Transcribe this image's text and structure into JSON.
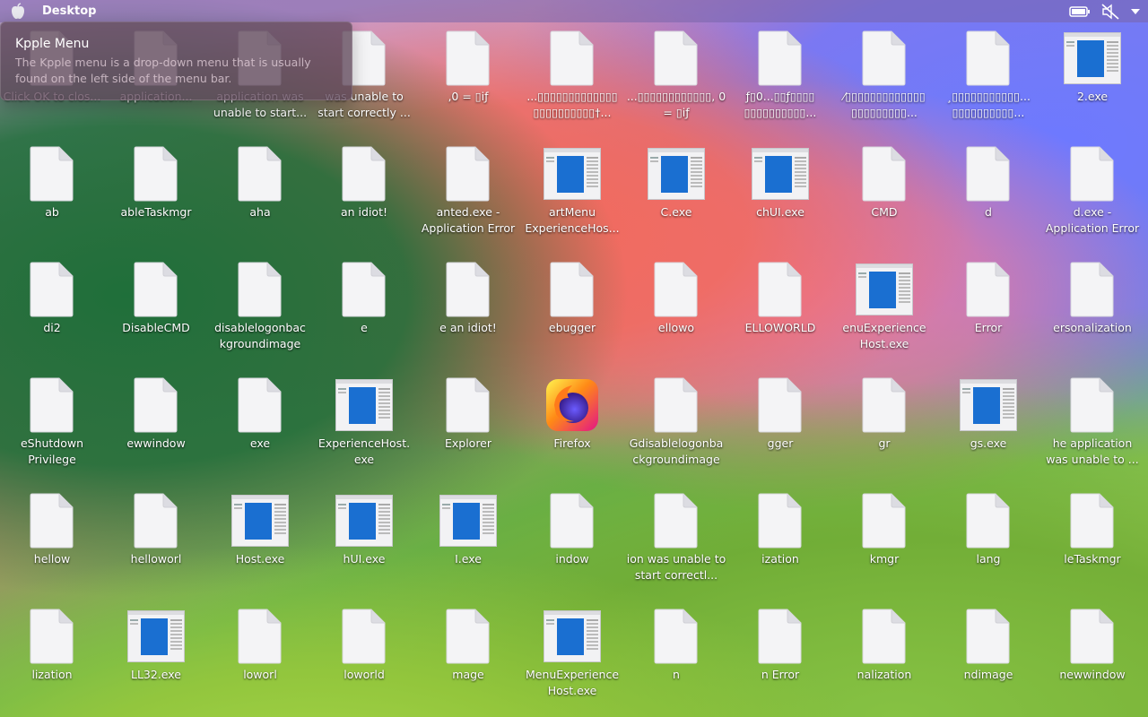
{
  "menubar": {
    "title": "Desktop"
  },
  "tooltip": {
    "title": "Kpple Menu",
    "body": "The Kpple menu is a drop-down menu that is usually found on the left side of the menu bar."
  },
  "desktop": {
    "items": [
      {
        "label": "Click OK to clos...",
        "icon": "file-icon"
      },
      {
        "label": "application...",
        "icon": "file-icon"
      },
      {
        "label": "application was unable to start...",
        "icon": "file-icon"
      },
      {
        "label": "was unable to start correctly ...",
        "icon": "file-icon"
      },
      {
        "label": ",0 = ▯iƒ",
        "icon": "file-icon"
      },
      {
        "label": "...▯▯▯▯▯▯▯▯▯▯▯▯▯ ▯▯▯▯▯▯▯▯▯▯†...",
        "icon": "file-icon"
      },
      {
        "label": "...▯▯▯▯▯▯▯▯▯▯▯▯, 0 = ▯iƒ",
        "icon": "file-icon"
      },
      {
        "label": "ƒ▯0...▯▯ƒ▯▯▯▯ ▯▯▯▯▯▯▯▯▯▯...",
        "icon": "file-icon"
      },
      {
        "label": "⁄▯▯▯▯▯▯▯▯▯▯▯▯▯ ▯▯▯▯▯▯▯▯▯...",
        "icon": "file-icon"
      },
      {
        "label": "¸▯▯▯▯▯▯▯▯▯▯▯... ▯▯▯▯▯▯▯▯▯▯...",
        "icon": "file-icon"
      },
      {
        "label": "2.exe",
        "icon": "app-window-icon"
      },
      {
        "label": "ab",
        "icon": "file-icon"
      },
      {
        "label": "ableTaskmgr",
        "icon": "file-icon"
      },
      {
        "label": "aha",
        "icon": "file-icon"
      },
      {
        "label": "an idiot!",
        "icon": "file-icon"
      },
      {
        "label": "anted.exe - Application Error",
        "icon": "file-icon"
      },
      {
        "label": "artMenu ExperienceHos...",
        "icon": "app-window-icon"
      },
      {
        "label": "C.exe",
        "icon": "app-window-icon"
      },
      {
        "label": "chUI.exe",
        "icon": "app-window-icon"
      },
      {
        "label": "CMD",
        "icon": "file-icon"
      },
      {
        "label": "d",
        "icon": "file-icon"
      },
      {
        "label": "d.exe - Application Error",
        "icon": "file-icon"
      },
      {
        "label": "di2",
        "icon": "file-icon"
      },
      {
        "label": "DisableCMD",
        "icon": "file-icon"
      },
      {
        "label": "disablelogonbac kgroundimage",
        "icon": "file-icon"
      },
      {
        "label": "e",
        "icon": "file-icon"
      },
      {
        "label": "e an idiot!",
        "icon": "file-icon"
      },
      {
        "label": "ebugger",
        "icon": "file-icon"
      },
      {
        "label": "ellowo",
        "icon": "file-icon"
      },
      {
        "label": "ELLOWORLD",
        "icon": "file-icon"
      },
      {
        "label": "enuExperience Host.exe",
        "icon": "app-window-icon"
      },
      {
        "label": "Error",
        "icon": "file-icon"
      },
      {
        "label": "ersonalization",
        "icon": "file-icon"
      },
      {
        "label": "eShutdown Privilege",
        "icon": "file-icon"
      },
      {
        "label": "ewwindow",
        "icon": "file-icon"
      },
      {
        "label": "exe",
        "icon": "file-icon"
      },
      {
        "label": "ExperienceHost. exe",
        "icon": "app-window-icon"
      },
      {
        "label": "Explorer",
        "icon": "file-icon"
      },
      {
        "label": "Firefox",
        "icon": "firefox-icon"
      },
      {
        "label": "Gdisablelogonba ckgroundimage",
        "icon": "file-icon"
      },
      {
        "label": "gger",
        "icon": "file-icon"
      },
      {
        "label": "gr",
        "icon": "file-icon"
      },
      {
        "label": "gs.exe",
        "icon": "app-window-icon"
      },
      {
        "label": "he application was unable to ...",
        "icon": "file-icon"
      },
      {
        "label": "hellow",
        "icon": "file-icon"
      },
      {
        "label": "helloworl",
        "icon": "file-icon"
      },
      {
        "label": "Host.exe",
        "icon": "app-window-icon"
      },
      {
        "label": "hUI.exe",
        "icon": "app-window-icon"
      },
      {
        "label": "I.exe",
        "icon": "app-window-icon"
      },
      {
        "label": "indow",
        "icon": "file-icon"
      },
      {
        "label": "ion was unable to start correctl...",
        "icon": "file-icon"
      },
      {
        "label": "ization",
        "icon": "file-icon"
      },
      {
        "label": "kmgr",
        "icon": "file-icon"
      },
      {
        "label": "lang",
        "icon": "file-icon"
      },
      {
        "label": "leTaskmgr",
        "icon": "file-icon"
      },
      {
        "label": "lization",
        "icon": "file-icon"
      },
      {
        "label": "LL32.exe",
        "icon": "app-window-icon"
      },
      {
        "label": "loworl",
        "icon": "file-icon"
      },
      {
        "label": "loworld",
        "icon": "file-icon"
      },
      {
        "label": "mage",
        "icon": "file-icon"
      },
      {
        "label": "MenuExperience Host.exe",
        "icon": "app-window-icon"
      },
      {
        "label": "n",
        "icon": "file-icon"
      },
      {
        "label": "n Error",
        "icon": "file-icon"
      },
      {
        "label": "nalization",
        "icon": "file-icon"
      },
      {
        "label": "ndimage",
        "icon": "file-icon"
      },
      {
        "label": "newwindow",
        "icon": "file-icon"
      }
    ]
  }
}
